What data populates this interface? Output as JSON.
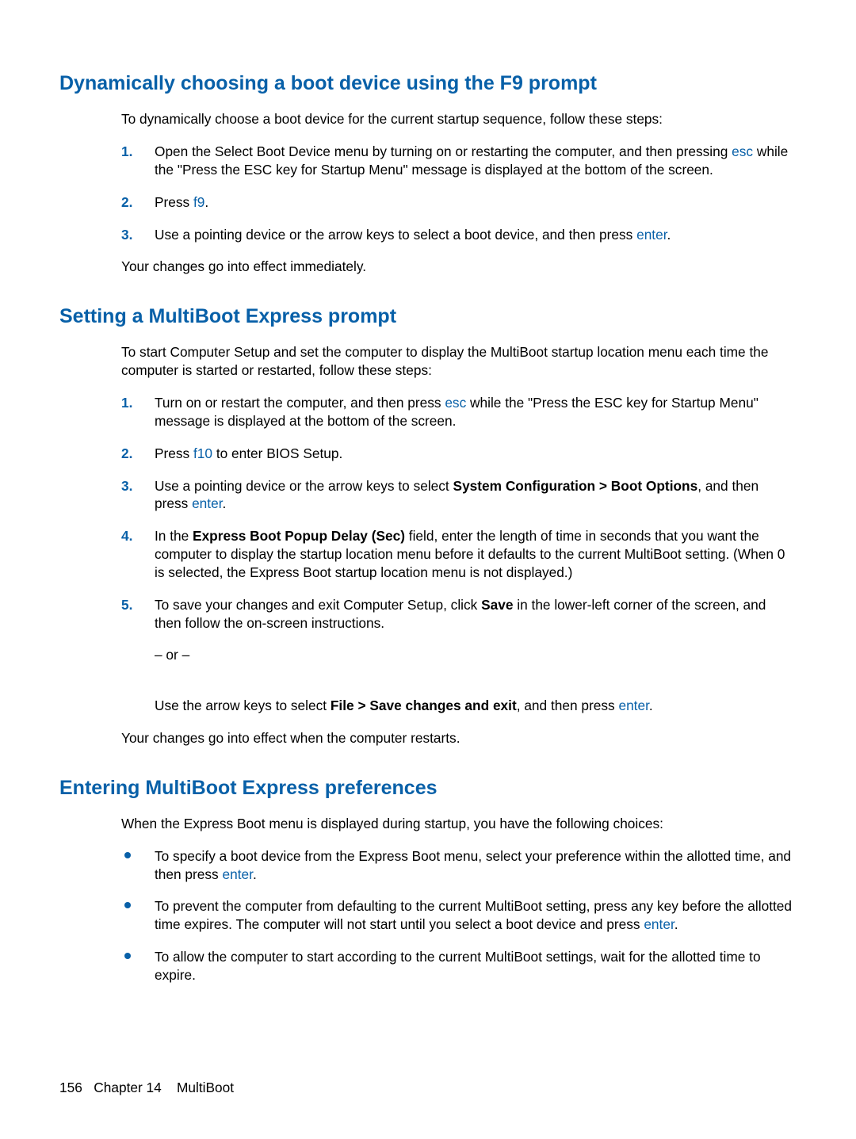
{
  "sections": [
    {
      "heading": "Dynamically choosing a boot device using the F9 prompt",
      "intro": "To dynamically choose a boot device for the current startup sequence, follow these steps:",
      "steps": [
        {
          "num": "1.",
          "parts": [
            {
              "t": "Open the Select Boot Device menu by turning on or restarting the computer, and then pressing "
            },
            {
              "t": "esc",
              "key": true
            },
            {
              "t": " while the \"Press the ESC key for Startup Menu\" message is displayed at the bottom of the screen."
            }
          ]
        },
        {
          "num": "2.",
          "parts": [
            {
              "t": "Press "
            },
            {
              "t": "f9",
              "key": true
            },
            {
              "t": "."
            }
          ]
        },
        {
          "num": "3.",
          "parts": [
            {
              "t": "Use a pointing device or the arrow keys to select a boot device, and then press "
            },
            {
              "t": "enter",
              "key": true
            },
            {
              "t": "."
            }
          ]
        }
      ],
      "outro": "Your changes go into effect immediately."
    },
    {
      "heading": "Setting a MultiBoot Express prompt",
      "intro": "To start Computer Setup and set the computer to display the MultiBoot startup location menu each time the computer is started or restarted, follow these steps:",
      "steps": [
        {
          "num": "1.",
          "parts": [
            {
              "t": "Turn on or restart the computer, and then press "
            },
            {
              "t": "esc",
              "key": true
            },
            {
              "t": " while the \"Press the ESC key for Startup Menu\" message is displayed at the bottom of the screen."
            }
          ]
        },
        {
          "num": "2.",
          "parts": [
            {
              "t": "Press "
            },
            {
              "t": "f10",
              "key": true
            },
            {
              "t": " to enter BIOS Setup."
            }
          ]
        },
        {
          "num": "3.",
          "parts": [
            {
              "t": "Use a pointing device or the arrow keys to select "
            },
            {
              "t": "System Configuration > Boot Options",
              "bold": true
            },
            {
              "t": ", and then press "
            },
            {
              "t": "enter",
              "key": true
            },
            {
              "t": "."
            }
          ]
        },
        {
          "num": "4.",
          "parts": [
            {
              "t": "In the "
            },
            {
              "t": "Express Boot Popup Delay (Sec)",
              "bold": true
            },
            {
              "t": " field, enter the length of time in seconds that you want the computer to display the startup location menu before it defaults to the current MultiBoot setting. (When 0 is selected, the Express Boot startup location menu is not displayed.)"
            }
          ]
        },
        {
          "num": "5.",
          "parts": [
            {
              "t": "To save your changes and exit Computer Setup, click "
            },
            {
              "t": "Save",
              "bold": true
            },
            {
              "t": " in the lower-left corner of the screen, and then follow the on-screen instructions."
            }
          ],
          "extra": [
            {
              "parts": [
                {
                  "t": "– or –"
                }
              ]
            },
            {
              "parts": [
                {
                  "t": "Use the arrow keys to select "
                },
                {
                  "t": "File > Save changes and exit",
                  "bold": true
                },
                {
                  "t": ", and then press "
                },
                {
                  "t": "enter",
                  "key": true
                },
                {
                  "t": "."
                }
              ]
            }
          ]
        }
      ],
      "outro": "Your changes go into effect when the computer restarts."
    },
    {
      "heading": "Entering MultiBoot Express preferences",
      "intro": "When the Express Boot menu is displayed during startup, you have the following choices:",
      "bullets": [
        {
          "parts": [
            {
              "t": "To specify a boot device from the Express Boot menu, select your preference within the allotted time, and then press "
            },
            {
              "t": "enter",
              "key": true
            },
            {
              "t": "."
            }
          ]
        },
        {
          "parts": [
            {
              "t": "To prevent the computer from defaulting to the current MultiBoot setting, press any key before the allotted time expires. The computer will not start until you select a boot device and press "
            },
            {
              "t": "enter",
              "key": true
            },
            {
              "t": "."
            }
          ]
        },
        {
          "parts": [
            {
              "t": "To allow the computer to start according to the current MultiBoot settings, wait for the allotted time to expire."
            }
          ]
        }
      ]
    }
  ],
  "footer": {
    "page": "156",
    "chapterLabel": "Chapter 14",
    "chapterTitle": "MultiBoot"
  }
}
